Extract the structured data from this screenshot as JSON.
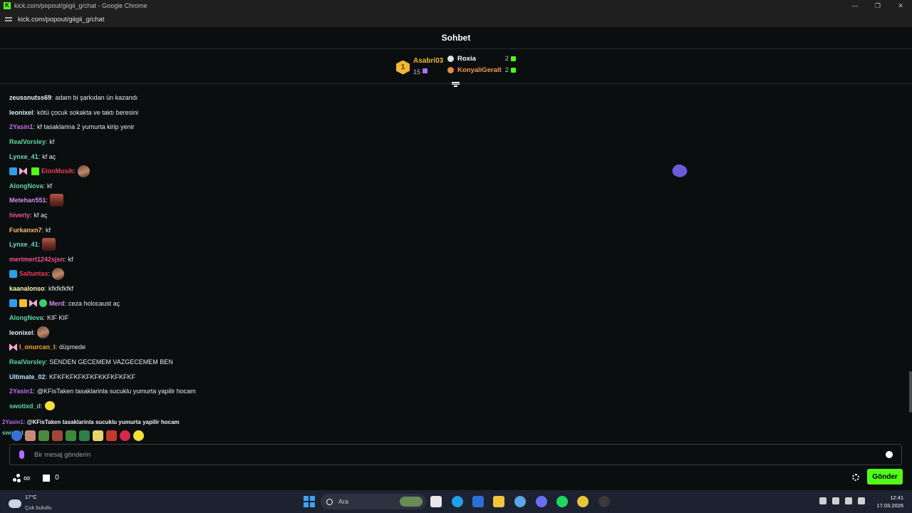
{
  "browser": {
    "window_title": "kick.com/popout/giigii_g/chat - Google Chrome",
    "url": "kick.com/popout/giigii_g/chat",
    "controls": [
      "—",
      "❐",
      "✕"
    ]
  },
  "chat": {
    "header": "Sohbet",
    "leaderboard": {
      "first": {
        "rank": "1",
        "name": "Asabri03",
        "count": "15"
      },
      "others": [
        {
          "name": "Roxia",
          "count": "2",
          "color": "#ffffff"
        },
        {
          "name": "KonyaliGeralt",
          "count": "2",
          "color": "#f39c4a"
        }
      ]
    },
    "messages": [
      {
        "user": "zeussnutss69",
        "color": "#e8f7ff",
        "text": "adam bi şarkıdan ün kazandı"
      },
      {
        "user": "leonixel",
        "color": "#d8f0ff",
        "text": "kötü çocuk sokakta ve taktı beresini"
      },
      {
        "user": "2Yasin1",
        "color": "#c16cf2",
        "text": "kf tasaklarina 2 yumurta kirip yenir"
      },
      {
        "user": "RealVorsley",
        "color": "#5ad7a1",
        "text": "kf"
      },
      {
        "user": "Lynxe_41",
        "color": "#6ad7c6",
        "text": "kf aç"
      },
      {
        "user": "ElonMusik",
        "color": "#ee3b58",
        "text": ""
      },
      {
        "user": "AlongNova",
        "color": "#5ad7a1",
        "text": "kf"
      },
      {
        "user": "Metehan551",
        "color": "#d58cf6",
        "text": ""
      },
      {
        "user": "hiverly",
        "color": "#f0558f",
        "text": "kf aç"
      },
      {
        "user": "Furkanxn7",
        "color": "#f5c16a",
        "text": "kf"
      },
      {
        "user": "Lynxe_41",
        "color": "#6ad7c6",
        "text": ""
      },
      {
        "user": "mertmert1242sjsn",
        "color": "#f0558f",
        "text": "kf"
      },
      {
        "user": "Saltuntas",
        "color": "#ee3b58",
        "text": ""
      },
      {
        "user": "kaanalonso",
        "color": "#fff6a8",
        "text": "kfkfkfkfkf"
      },
      {
        "user": "Merd",
        "color": "#d58cf6",
        "text": "ceza holocaust aç"
      },
      {
        "user": "AlongNova",
        "color": "#5ad7a1",
        "text": "KIF KIF"
      },
      {
        "user": "leonixel",
        "color": "#d8f0ff",
        "text": ""
      },
      {
        "user": "I_onurcan_I",
        "color": "#f5a623",
        "text": "düşmede"
      },
      {
        "user": "RealVorsley",
        "color": "#5ad7a1",
        "text": "SENDEN GECEMEM VAZGECEMEM BEN"
      },
      {
        "user": "Ultimate_02",
        "color": "#b7e4ff",
        "text": "KFKFKFKFKFKFKKFKFKFKF"
      },
      {
        "user": "2Yasin1",
        "color": "#c16cf2",
        "text": "@KFisTaken tasaklarinla sucuklu yumurta yapilir hocam"
      },
      {
        "user": "swotixd_d",
        "color": "#5ad7a1",
        "text": ""
      }
    ],
    "overlay": {
      "ghost_user": "2Yasin1",
      "ghost_text": "@KFisTaken tasaklarinla sucuklu yumurta yapilir hocam",
      "ghost_user2": "swotixd_d"
    },
    "input": {
      "placeholder": "Bir mesaj gönderin"
    },
    "points": {
      "value": "∞",
      "shop_count": "0"
    },
    "send_label": "Gönder"
  },
  "taskbar": {
    "weather_temp": "17°C",
    "weather_cond": "Çok bulutlu",
    "search_label": "Ara",
    "time": "12:41",
    "date": "17.03.2026"
  }
}
